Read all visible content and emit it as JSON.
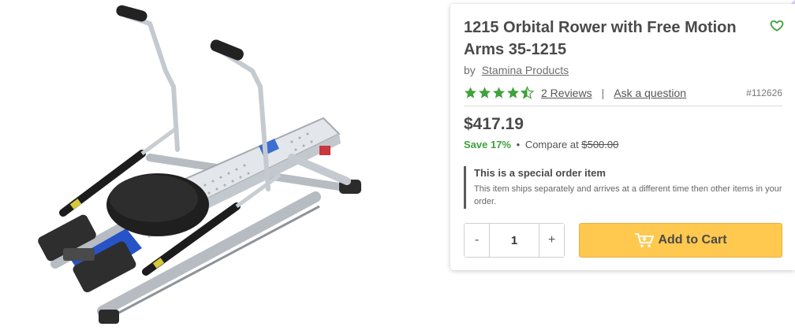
{
  "product": {
    "title": "1215 Orbital Rower with Free Motion Arms 35-1215",
    "by_label": "by",
    "brand": "Stamina Products",
    "rating": 4.5,
    "reviews_label": "2 Reviews",
    "separator": "|",
    "ask_label": "Ask a question",
    "sku": "#112626",
    "price": "$417.19",
    "save_label": "Save 17%",
    "bullet": "•",
    "compare_label": "Compare at",
    "compare_price": "$500.00"
  },
  "notice": {
    "title": "This is a special order item",
    "text": "This item ships separately and arrives at a different time then other items in your order."
  },
  "cart": {
    "minus_label": "-",
    "quantity": "1",
    "plus_label": "+",
    "add_label": "Add to Cart"
  },
  "icons": {
    "favorite": "heart-icon",
    "cart": "cart-icon",
    "stars": "star-icon"
  },
  "colors": {
    "accent_green": "#3fa23b",
    "button_yellow": "#ffc94f"
  }
}
